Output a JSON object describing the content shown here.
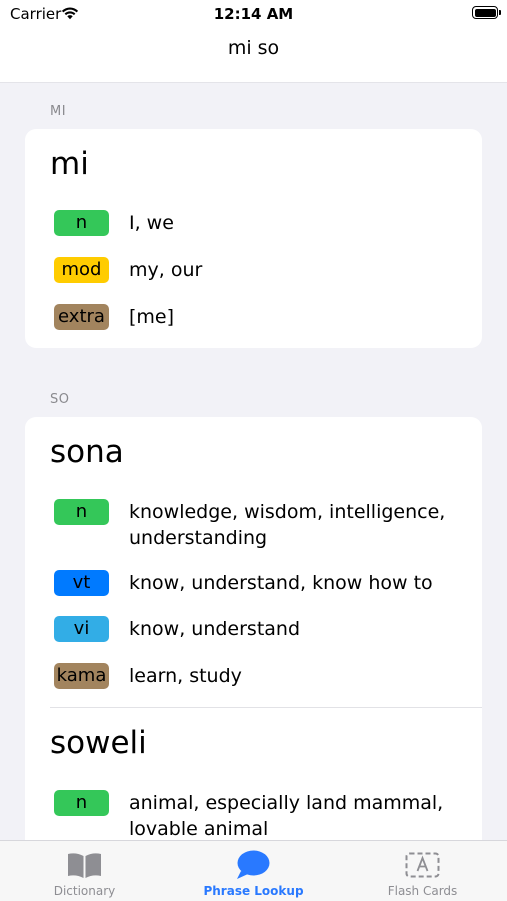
{
  "status_bar": {
    "carrier": "Carrier",
    "time": "12:14 AM"
  },
  "nav": {
    "title": "mi so"
  },
  "sections": [
    {
      "header": "MI",
      "entries": [
        {
          "word": "mi",
          "defs": [
            {
              "tag": "n",
              "color": "#34c759",
              "text": "I, we"
            },
            {
              "tag": "mod",
              "color": "#ffcc00",
              "text": "my, our"
            },
            {
              "tag": "extra",
              "color": "#a2845e",
              "text": "[me]"
            }
          ]
        }
      ]
    },
    {
      "header": "SO",
      "entries": [
        {
          "word": "sona",
          "defs": [
            {
              "tag": "n",
              "color": "#34c759",
              "text": "knowledge, wisdom, intelligence, understanding"
            },
            {
              "tag": "vt",
              "color": "#007aff",
              "text": "know, understand, know how to"
            },
            {
              "tag": "vi",
              "color": "#32ade6",
              "text": "know, understand"
            },
            {
              "tag": "kama",
              "color": "#a2845e",
              "text": "learn, study"
            }
          ]
        },
        {
          "word": "soweli",
          "defs": [
            {
              "tag": "n",
              "color": "#34c759",
              "text": "animal, especially land mammal, lovable animal"
            }
          ]
        }
      ]
    }
  ],
  "tabbar": {
    "tabs": [
      {
        "label": "Dictionary",
        "icon": "book-icon",
        "active": false
      },
      {
        "label": "Phrase Lookup",
        "icon": "speech-bubble-icon",
        "active": true
      },
      {
        "label": "Flash Cards",
        "icon": "flash-card-icon",
        "active": false
      }
    ]
  },
  "colors": {
    "accent": "#2979ff",
    "inactive": "#8e8e93"
  }
}
